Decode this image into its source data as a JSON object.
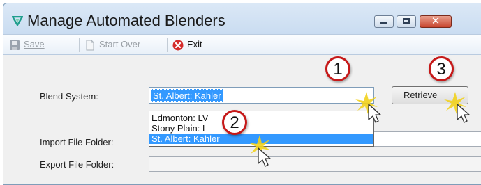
{
  "window": {
    "title": "Manage Automated Blenders",
    "controls": [
      "minimize",
      "maximize",
      "close"
    ],
    "close_glyph": "✕"
  },
  "toolbar": {
    "save_label": "Save",
    "start_over_label": "Start Over",
    "exit_label": "Exit"
  },
  "form": {
    "blend_system_label": "Blend System:",
    "blend_system_value": "St. Albert: Kahler",
    "blend_system_options": [
      "Edmonton: LV",
      "Stony Plain: L",
      "St. Albert: Kahler"
    ],
    "import_folder_label": "Import File Folder:",
    "import_folder_value": "",
    "export_folder_label": "Export File Folder:",
    "export_folder_value": "",
    "retrieve_label": "Retrieve"
  },
  "callouts": [
    "1",
    "2",
    "3"
  ],
  "colors": {
    "selection": "#3399ff",
    "callout_ring": "#c61818",
    "sparkle": "#f2d21c",
    "exit_icon": "#d42b2b",
    "app_icon": "#1e9e8c"
  }
}
